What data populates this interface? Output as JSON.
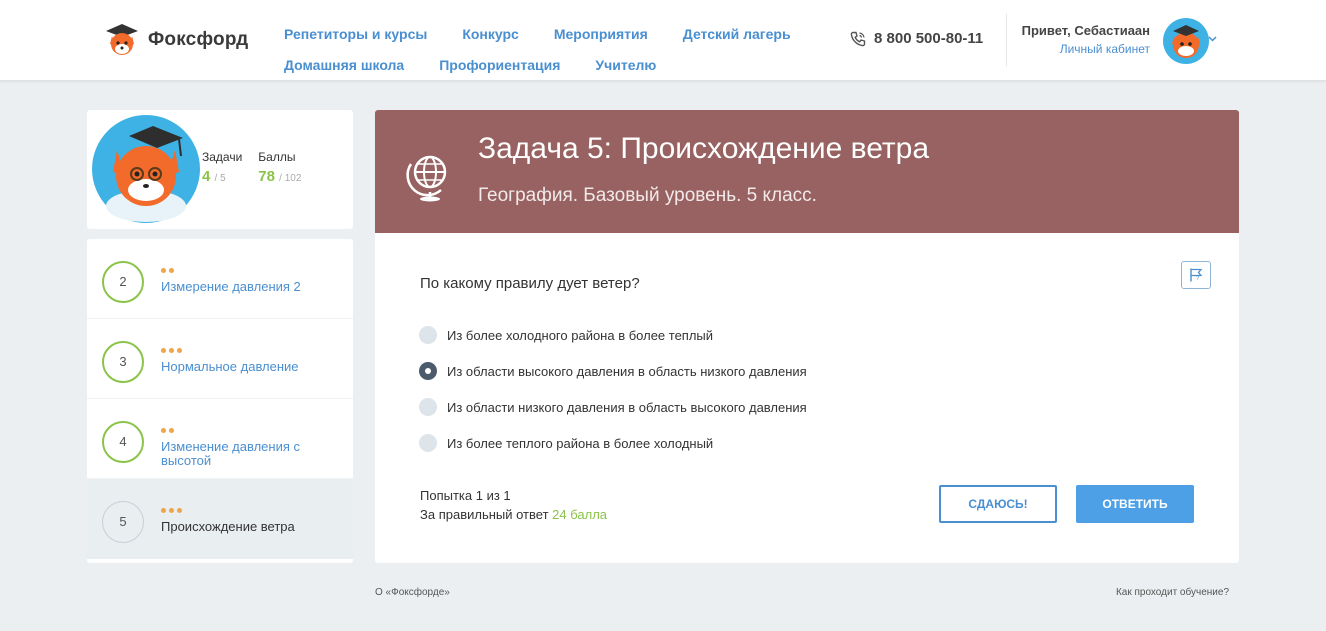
{
  "header": {
    "logo_text": "Фоксфорд",
    "nav_row1": [
      "Репетиторы и курсы",
      "Конкурс",
      "Мероприятия",
      "Детский лагерь"
    ],
    "nav_row2": [
      "Домашняя школа",
      "Профориентация",
      "Учителю"
    ],
    "phone": "8 800 500-80-11",
    "greeting": "Привет, Себастиаан",
    "cabinet_link": "Личный кабинет"
  },
  "profile": {
    "tasks_label": "Задачи",
    "tasks_done": "4",
    "tasks_total": "/ 5",
    "points_label": "Баллы",
    "points_value": "78",
    "points_total": "/ 102"
  },
  "tasks": [
    {
      "num": "2",
      "title": "Измерение давления 2",
      "difficulty": 2
    },
    {
      "num": "3",
      "title": "Нормальное давление",
      "difficulty": 3
    },
    {
      "num": "4",
      "title": "Изменение давления с высотой",
      "difficulty": 2
    },
    {
      "num": "5",
      "title": "Происхождение ветра",
      "difficulty": 3
    }
  ],
  "task": {
    "title": "Задача 5: Происхождение ветра",
    "subtitle": "География. Базовый уровень. 5 класс.",
    "question": "По какому правилу дует ветер?",
    "options": [
      "Из более холодного района в более теплый",
      "Из области высокого давления в область низкого давления",
      "Из области низкого давления в область высокого давления",
      "Из более теплого района в более холодный"
    ],
    "selected_option": 1,
    "attempt_text": "Попытка 1 из 1",
    "reward_prefix": "За правильный ответ",
    "reward_points": "24 балла",
    "giveup_label": "СДАЮСЬ!",
    "answer_label": "ОТВЕТИТЬ"
  },
  "footer": {
    "about": "О «Фоксфорде»",
    "how": "Как проходит обучение?"
  },
  "colors": {
    "accent": "#4a8fd0",
    "header_bg": "#976261",
    "success": "#8bc34a",
    "dots": "#f0a44b"
  }
}
